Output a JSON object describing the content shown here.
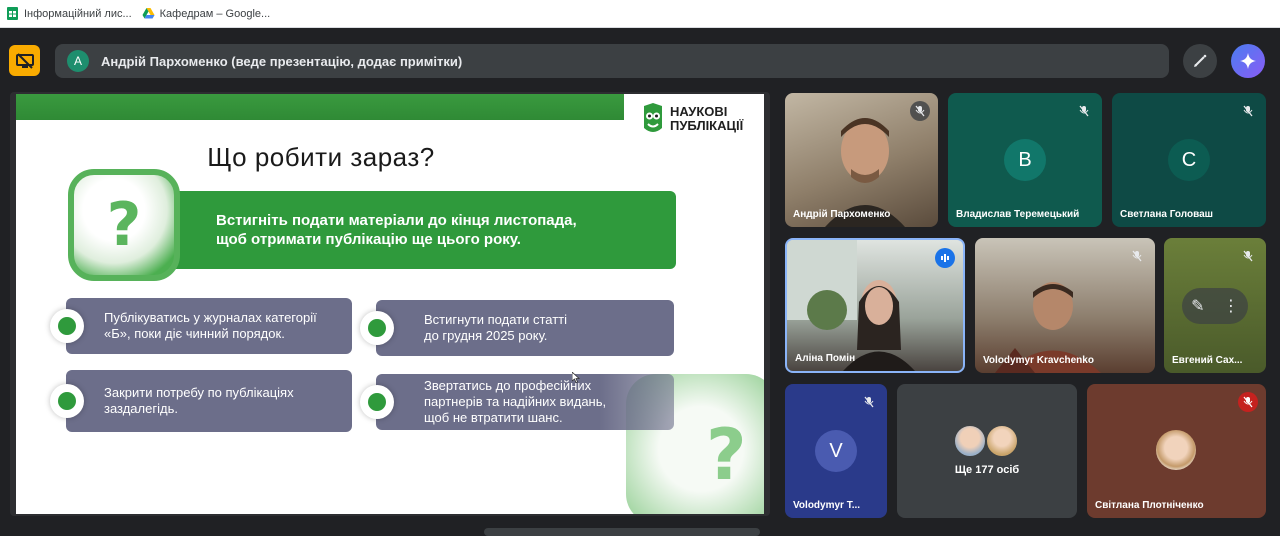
{
  "bookmarks": [
    {
      "label": "Інформаційний лис...",
      "icon": "sheets-icon"
    },
    {
      "label": "Кафедрам – Google...",
      "icon": "drive-icon"
    }
  ],
  "presenter": {
    "avatar_letter": "A",
    "text": "Андрій Пархоменко (веде презентацію, додає примітки)"
  },
  "slide": {
    "logo_line1": "НАУКОВІ",
    "logo_line2": "ПУБЛІКАЦІЇ",
    "title": "Що робити зараз?",
    "banner": "Встигніть подати матеріали до кінця листопада,\nщоб отримати публікацію ще цього року.",
    "items": [
      "Публікуватись у журналах категорії\n«Б», поки діє чинний порядок.",
      "Встигнути подати статті\nдо грудня 2025 року.",
      "Закрити потребу по публікаціях\nзаздалегідь.",
      "Звертатись до професійних\nпартнерів та надійних видань,\nщоб не втратити шанс."
    ]
  },
  "participants": [
    {
      "name": "Андрій Пархоменко",
      "type": "video"
    },
    {
      "name": "Владислав Теремецький",
      "letter": "В",
      "type": "avatar"
    },
    {
      "name": "Светлана Головаш",
      "letter": "С",
      "type": "avatar"
    },
    {
      "name": "Аліна Помін",
      "type": "video"
    },
    {
      "name": "Volodymyr Kravchenko",
      "type": "video"
    },
    {
      "name": "Евгений Сах...",
      "type": "video"
    },
    {
      "name": "Volodymyr T...",
      "letter": "V",
      "type": "avatar"
    },
    {
      "name": "Світлана Плотніченко",
      "type": "avatar"
    }
  ],
  "others": {
    "label": "Ще 177 осіб"
  },
  "colors": {
    "meet_bg": "#202124",
    "slide_green": "#2f9a3c",
    "item_bg": "#6c6e8a",
    "accent_yellow": "#f9ab00",
    "gemini_blue": "#4a7df0"
  }
}
